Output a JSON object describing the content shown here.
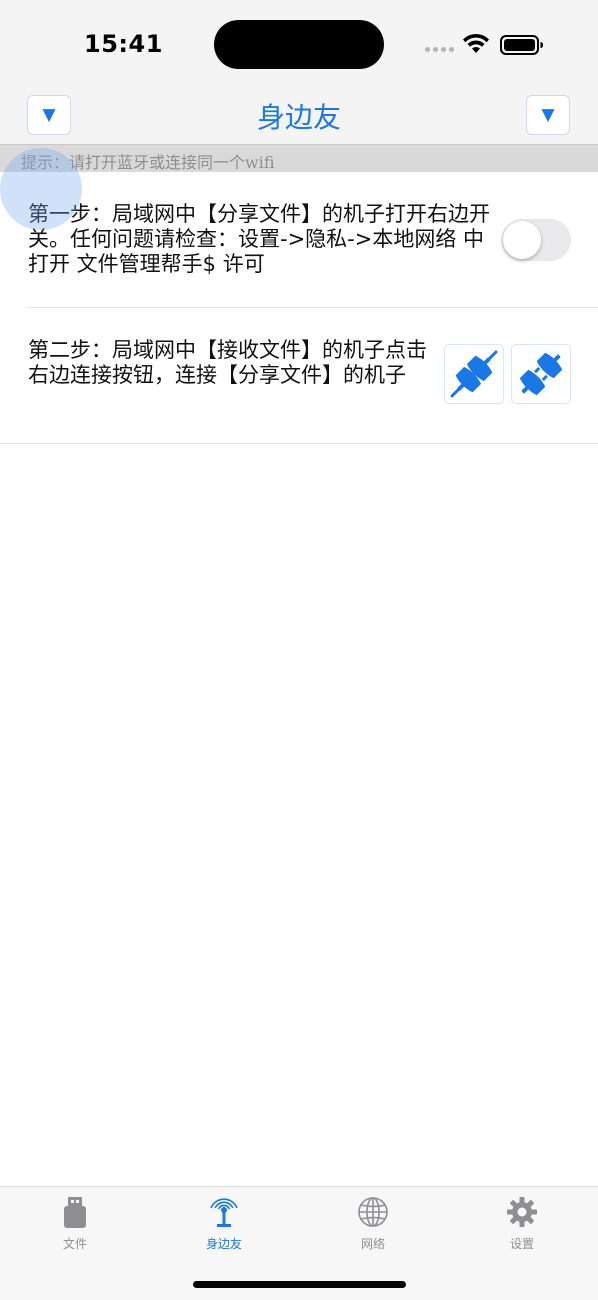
{
  "status_bar": {
    "time": "15:41"
  },
  "nav": {
    "title": "身边友",
    "left_button": "▼",
    "right_button": "▼"
  },
  "hint": {
    "text": "提示：请打开蓝牙或连接同一个wifi"
  },
  "step1": {
    "text": "第一步：局域网中【分享文件】的机子打开右边开关。任何问题请检查：设置->隐私->本地网络 中打开 文件管理帮手$ 许可",
    "toggle_on": false
  },
  "step2": {
    "text": "第二步：局域网中【接收文件】的机子点击右边连接按钮，连接【分享文件】的机子",
    "connect_icon": "plug-connected-icon",
    "disconnect_icon": "plug-disconnected-icon"
  },
  "tabs": [
    {
      "label": "文件",
      "icon": "usb-drive-icon",
      "active": false
    },
    {
      "label": "身边友",
      "icon": "broadcast-antenna-icon",
      "active": true
    },
    {
      "label": "网络",
      "icon": "globe-icon",
      "active": false
    },
    {
      "label": "设置",
      "icon": "gear-icon",
      "active": false
    }
  ],
  "colors": {
    "accent": "#1a78e6",
    "inactive": "#8e8e93",
    "hint_bg": "#d9d9d9"
  }
}
